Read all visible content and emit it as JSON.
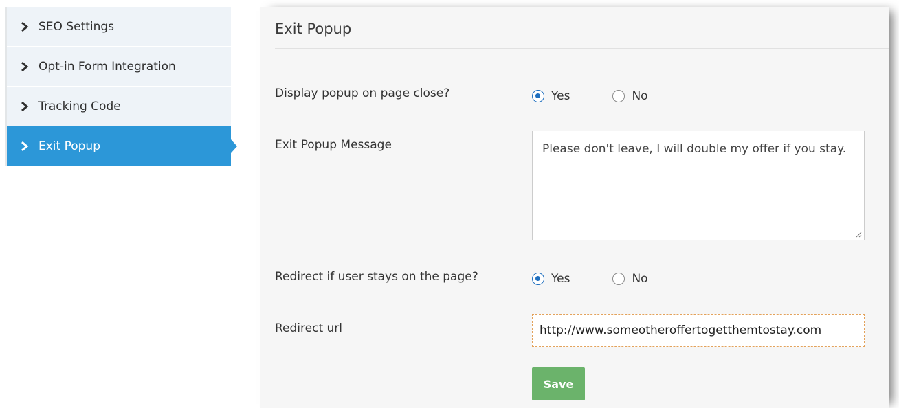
{
  "sidebar": {
    "items": [
      {
        "label": "SEO Settings",
        "icon": "chevron-right-icon",
        "active": false
      },
      {
        "label": "Opt-in Form Integration",
        "icon": "chevron-right-icon",
        "active": false
      },
      {
        "label": "Tracking Code",
        "icon": "chevron-right-icon",
        "active": false
      },
      {
        "label": "Exit Popup",
        "icon": "chevron-right-icon",
        "active": true
      }
    ],
    "active_color": "#2c97d8"
  },
  "panel": {
    "title": "Exit Popup",
    "display_popup": {
      "label": "Display popup on page close?",
      "options": [
        "Yes",
        "No"
      ],
      "selected": "Yes"
    },
    "message": {
      "label": "Exit Popup Message",
      "value": "Please don't leave, I will double my offer if you stay."
    },
    "redirect": {
      "label": "Redirect if user stays on the page?",
      "options": [
        "Yes",
        "No"
      ],
      "selected": "Yes"
    },
    "redirect_url": {
      "label": "Redirect url",
      "value": "http://www.someotheroffertogetthemtostay.com"
    },
    "save_label": "Save",
    "save_color": "#6bb36b"
  }
}
